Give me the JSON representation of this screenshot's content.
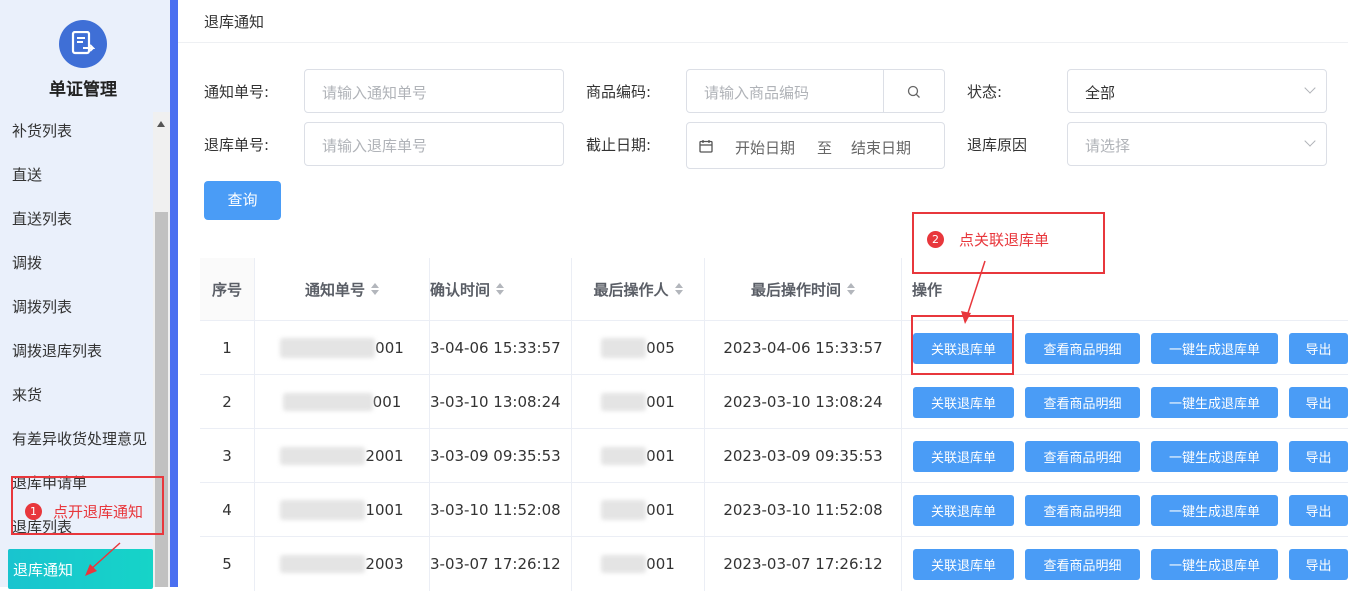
{
  "sidebar": {
    "module_title": "单证管理",
    "items": [
      {
        "label": "补货列表"
      },
      {
        "label": "直送"
      },
      {
        "label": "直送列表"
      },
      {
        "label": "调拨"
      },
      {
        "label": "调拨列表"
      },
      {
        "label": "调拨退库列表"
      },
      {
        "label": "来货"
      },
      {
        "label": "有差异收货处理意见"
      },
      {
        "label": "退库申请单"
      },
      {
        "label": "退库列表"
      },
      {
        "label": "退库通知"
      }
    ]
  },
  "page": {
    "title": "退库通知"
  },
  "filters": {
    "notice_no": {
      "label": "通知单号:",
      "placeholder": "请输入通知单号"
    },
    "product_code": {
      "label": "商品编码:",
      "placeholder": "请输入商品编码"
    },
    "status": {
      "label": "状态:",
      "value": "全部"
    },
    "return_no": {
      "label": "退库单号:",
      "placeholder": "请输入退库单号"
    },
    "deadline": {
      "label": "截止日期:",
      "start_placeholder": "开始日期",
      "separator": "至",
      "end_placeholder": "结束日期"
    },
    "return_reason": {
      "label": "退库原因",
      "placeholder": "请选择"
    },
    "query_label": "查询"
  },
  "table": {
    "columns": [
      "序号",
      "通知单号",
      "确认时间",
      "最后操作人",
      "最后操作时间",
      "操作"
    ],
    "actions": [
      "关联退库单",
      "查看商品明细",
      "一键生成退库单",
      "导出"
    ],
    "rows": [
      {
        "index": "1",
        "notice_suffix": "001",
        "confirm_time": "3-04-06 15:33:57",
        "operator_suffix": "005",
        "last_time": "2023-04-06 15:33:57"
      },
      {
        "index": "2",
        "notice_suffix": "001",
        "confirm_time": "3-03-10 13:08:24",
        "operator_suffix": "001",
        "last_time": "2023-03-10 13:08:24"
      },
      {
        "index": "3",
        "notice_suffix": "2001",
        "confirm_time": "3-03-09 09:35:53",
        "operator_suffix": "001",
        "last_time": "2023-03-09 09:35:53"
      },
      {
        "index": "4",
        "notice_suffix": "1001",
        "confirm_time": "3-03-10 11:52:08",
        "operator_suffix": "001",
        "last_time": "2023-03-10 11:52:08"
      },
      {
        "index": "5",
        "notice_suffix": "2003",
        "confirm_time": "3-03-07 17:26:12",
        "operator_suffix": "001",
        "last_time": "2023-03-07 17:26:12"
      }
    ]
  },
  "annotations": {
    "step1": {
      "badge": "1",
      "text": "点开退库通知"
    },
    "step2": {
      "badge": "2",
      "text": "点关联退库单"
    },
    "color": "#e8373c"
  },
  "colors": {
    "primary": "#4a9cf6",
    "active_menu": "#19c4cf",
    "accent_bar": "#4a6ff0"
  }
}
